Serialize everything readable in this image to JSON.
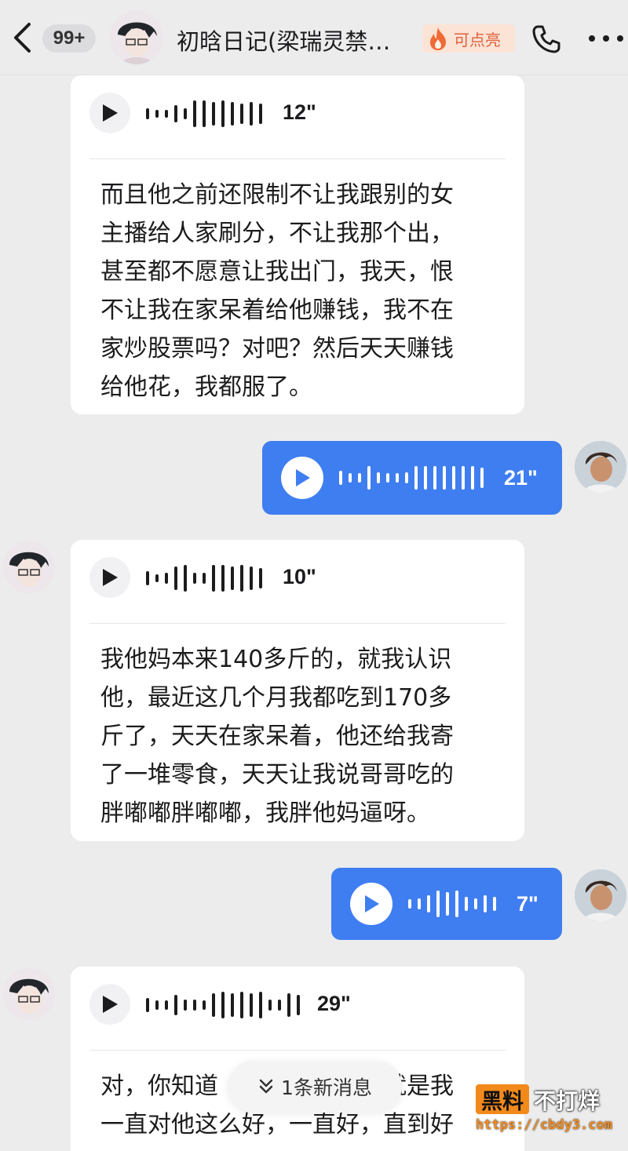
{
  "header": {
    "unread_badge": "99+",
    "title": "初晗日记(梁瑞灵禁…",
    "fire_label": "可点亮"
  },
  "messages": [
    {
      "side": "received",
      "duration": "12\"",
      "transcript": [
        "而且他之前还限制不让我跟别的女",
        "主播给人家刷分，不让我那个出，",
        "甚至都不愿意让我出门，我天，恨",
        "不让我在家呆着给他赚钱，我不在",
        "家炒股票吗？对吧？然后天天赚钱",
        "给他花，我都服了。"
      ]
    },
    {
      "side": "sent",
      "duration": "21\""
    },
    {
      "side": "received",
      "duration": "10\"",
      "transcript": [
        "我他妈本来140多斤的，就我认识",
        "他，最近这几个月我都吃到170多",
        "斤了，天天在家呆着，他还给我寄",
        "了一堆零食，天天让我说哥哥吃的",
        "胖嘟嘟胖嘟嘟，我胖他妈逼呀。"
      ]
    },
    {
      "side": "sent",
      "duration": "7\""
    },
    {
      "side": "received",
      "duration": "29\"",
      "transcript": [
        "对，你知道　　　　　　　就是我",
        "一直对他这么好，一直好，直到好"
      ]
    }
  ],
  "new_message_pill": "1条新消息",
  "watermark": {
    "badge": "黑料",
    "text": "不打烊",
    "url": "https://cbdy3.com"
  },
  "colors": {
    "background": "#ececed",
    "sent_bubble": "#3f7ef0",
    "received_card": "#ffffff",
    "fire_accent": "#e0613c"
  }
}
